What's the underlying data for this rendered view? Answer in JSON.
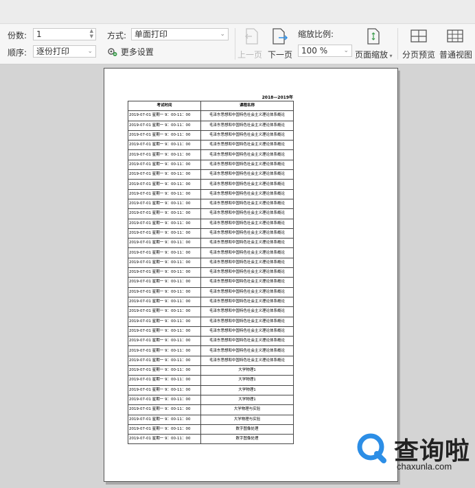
{
  "toolbar": {
    "copies_label": "份数:",
    "copies_value": "1",
    "order_label": "顺序:",
    "order_value": "逐份打印",
    "mode_label": "方式:",
    "mode_value": "单面打印",
    "more_settings": "更多设置",
    "prev_page": "上一页",
    "next_page": "下一页",
    "zoom_label": "缩放比例:",
    "zoom_value": "100 %",
    "page_zoom": "页面缩放",
    "page_break_preview": "分页预览",
    "normal_view": "普通视图"
  },
  "sheet": {
    "title": "2018—2019年",
    "headers": [
      "考试时间",
      "课程名称"
    ],
    "rows": [
      [
        "2019-07-01 星期一 9：00-11：00",
        "毛泽东思想和中国特色社会主义理论体系概论"
      ],
      [
        "2019-07-01 星期一 9：00-11：00",
        "毛泽东思想和中国特色社会主义理论体系概论"
      ],
      [
        "2019-07-01 星期一 9：00-11：00",
        "毛泽东思想和中国特色社会主义理论体系概论"
      ],
      [
        "2019-07-01 星期一 9：00-11：00",
        "毛泽东思想和中国特色社会主义理论体系概论"
      ],
      [
        "2019-07-01 星期一 9：00-11：00",
        "毛泽东思想和中国特色社会主义理论体系概论"
      ],
      [
        "2019-07-01 星期一 9：00-11：00",
        "毛泽东思想和中国特色社会主义理论体系概论"
      ],
      [
        "2019-07-01 星期一 9：00-11：00",
        "毛泽东思想和中国特色社会主义理论体系概论"
      ],
      [
        "2019-07-01 星期一 9：00-11：00",
        "毛泽东思想和中国特色社会主义理论体系概论"
      ],
      [
        "2019-07-01 星期一 9：00-11：00",
        "毛泽东思想和中国特色社会主义理论体系概论"
      ],
      [
        "2019-07-01 星期一 9：00-11：00",
        "毛泽东思想和中国特色社会主义理论体系概论"
      ],
      [
        "2019-07-01 星期一 9：00-11：00",
        "毛泽东思想和中国特色社会主义理论体系概论"
      ],
      [
        "2019-07-01 星期一 9：00-11：00",
        "毛泽东思想和中国特色社会主义理论体系概论"
      ],
      [
        "2019-07-01 星期一 9：00-11：00",
        "毛泽东思想和中国特色社会主义理论体系概论"
      ],
      [
        "2019-07-01 星期一 9：00-11：00",
        "毛泽东思想和中国特色社会主义理论体系概论"
      ],
      [
        "2019-07-01 星期一 9：00-11：00",
        "毛泽东思想和中国特色社会主义理论体系概论"
      ],
      [
        "2019-07-01 星期一 9：00-11：00",
        "毛泽东思想和中国特色社会主义理论体系概论"
      ],
      [
        "2019-07-01 星期一 9：00-11：00",
        "毛泽东思想和中国特色社会主义理论体系概论"
      ],
      [
        "2019-07-01 星期一 9：00-11：00",
        "毛泽东思想和中国特色社会主义理论体系概论"
      ],
      [
        "2019-07-01 星期一 9：00-11：00",
        "毛泽东思想和中国特色社会主义理论体系概论"
      ],
      [
        "2019-07-01 星期一 9：00-11：00",
        "毛泽东思想和中国特色社会主义理论体系概论"
      ],
      [
        "2019-07-01 星期一 9：00-11：00",
        "毛泽东思想和中国特色社会主义理论体系概论"
      ],
      [
        "2019-07-01 星期一 9：00-11：00",
        "毛泽东思想和中国特色社会主义理论体系概论"
      ],
      [
        "2019-07-01 星期一 9：00-11：00",
        "毛泽东思想和中国特色社会主义理论体系概论"
      ],
      [
        "2019-07-01 星期一 9：00-11：00",
        "毛泽东思想和中国特色社会主义理论体系概论"
      ],
      [
        "2019-07-01 星期一 9：00-11：00",
        "毛泽东思想和中国特色社会主义理论体系概论"
      ],
      [
        "2019-07-01 星期一 9：00-11：00",
        "毛泽东思想和中国特色社会主义理论体系概论"
      ],
      [
        "2019-07-01 星期一 9：00-11：00",
        "大学物理1"
      ],
      [
        "2019-07-01 星期一 9：00-11：00",
        "大学物理1"
      ],
      [
        "2019-07-01 星期一 9：00-11：00",
        "大学物理1"
      ],
      [
        "2019-07-01 星期一 9：00-11：00",
        "大学物理1"
      ],
      [
        "2019-07-01 星期一 9：00-11：00",
        "大学物理与实验"
      ],
      [
        "2019-07-01 星期一 9：00-11：00",
        "大学物理与实验"
      ],
      [
        "2019-07-01 星期一 9：00-11：00",
        "数字图像处理"
      ],
      [
        "2019-07-01 星期一 9：00-11：00",
        "数字图像处理"
      ]
    ]
  },
  "watermark": {
    "text": "查询啦",
    "url": "chaxunla.com"
  },
  "colors": {
    "watermark_blue": "#2c8ee6",
    "disabled_text": "#b8b8b8"
  }
}
